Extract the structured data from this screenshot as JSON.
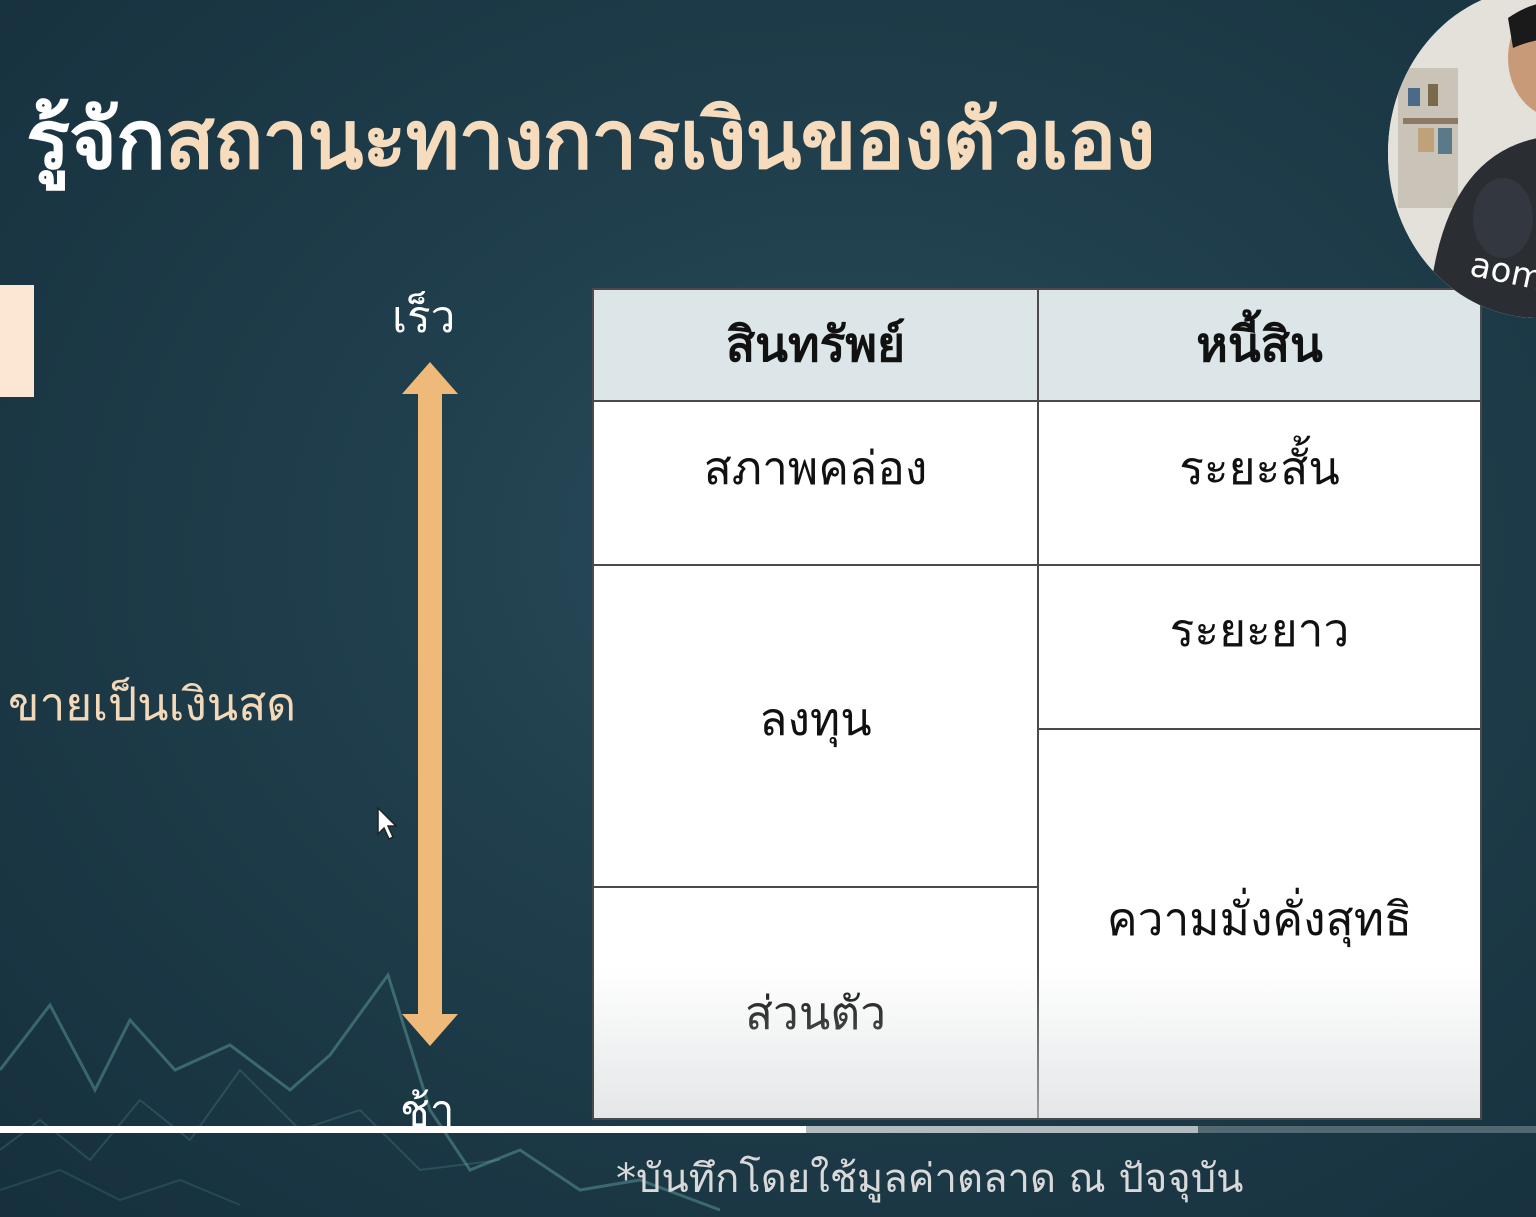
{
  "slide": {
    "title_part1": "รู้จัก",
    "title_part2": "สถานะทางการเงินของตัวเอง",
    "side_label": "ขายเป็นเงินสด",
    "arrow_top_label": "เร็ว",
    "arrow_bottom_label": "ช้า",
    "footnote": "*บันทึกโดยใช้มูลค่าตลาด ณ ปัจจุบัน",
    "colors": {
      "title_white": "#ffffff",
      "title_gold": "#f6dcbc",
      "arrow": "#efb97a",
      "table_header": "#dce6e9",
      "background": "#1f3d4b"
    }
  },
  "table": {
    "headers": [
      "สินทรัพย์",
      "หนี้สิน"
    ],
    "assets": [
      "สภาพคล่อง",
      "ลงทุน",
      "ส่วนตัว"
    ],
    "liabilities": [
      "ระยะสั้น",
      "ระยะยาว"
    ],
    "net_worth": "ความมั่งคั่งสุทธิ"
  },
  "webcam": {
    "name": "aom"
  },
  "player": {
    "progress": 0.525,
    "buffered": 0.78
  }
}
